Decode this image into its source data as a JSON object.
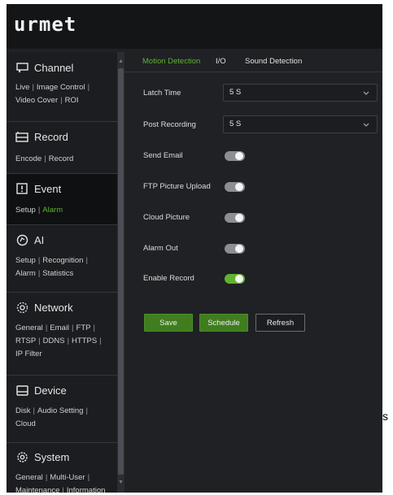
{
  "brand": {
    "logo": "urmet"
  },
  "sidebar": {
    "channel": {
      "title": "Channel",
      "links": [
        "Live",
        "Image Control",
        "Video Cover",
        "ROI"
      ]
    },
    "record": {
      "title": "Record",
      "links": [
        "Encode",
        "Record"
      ]
    },
    "event": {
      "title": "Event",
      "links": [
        "Setup",
        "Alarm"
      ]
    },
    "ai": {
      "title": "AI",
      "links": [
        "Setup",
        "Recognition",
        "Alarm",
        "Statistics"
      ]
    },
    "network": {
      "title": "Network",
      "links": [
        "General",
        "Email",
        "FTP",
        "RTSP",
        "DDNS",
        "HTTPS",
        "IP Filter"
      ]
    },
    "device": {
      "title": "Device",
      "links": [
        "Disk",
        "Audio Setting",
        "Cloud"
      ]
    },
    "system": {
      "title": "System",
      "links": [
        "General",
        "Multi-User",
        "Maintenance",
        "Information"
      ]
    }
  },
  "tabs": [
    "Motion Detection",
    "I/O",
    "Sound Detection"
  ],
  "form": {
    "latch_time": {
      "label": "Latch Time",
      "value": "5 S"
    },
    "post_recording": {
      "label": "Post Recording",
      "value": "5 S"
    },
    "send_email": {
      "label": "Send Email",
      "enabled": false
    },
    "ftp_picture_upload": {
      "label": "FTP Picture Upload",
      "enabled": false
    },
    "cloud_picture": {
      "label": "Cloud Picture",
      "enabled": false
    },
    "alarm_out": {
      "label": "Alarm Out",
      "enabled": false
    },
    "enable_record": {
      "label": "Enable Record",
      "enabled": true
    }
  },
  "buttons": {
    "save": "Save",
    "schedule": "Schedule",
    "refresh": "Refresh"
  },
  "stray_text": "s",
  "colors": {
    "accent": "#5fb331",
    "background": "#1f2124",
    "topbar": "#141517"
  }
}
